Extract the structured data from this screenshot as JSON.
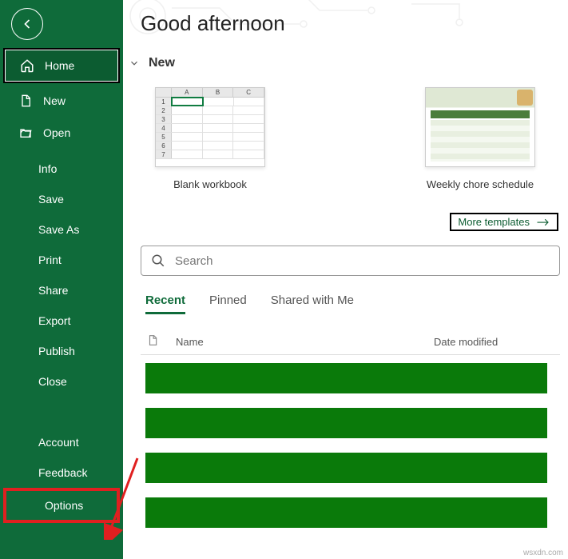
{
  "sidebar": {
    "items": [
      {
        "label": "Home",
        "icon": "home-icon",
        "selected": true
      },
      {
        "label": "New",
        "icon": "document-icon"
      },
      {
        "label": "Open",
        "icon": "folder-icon"
      }
    ],
    "secondary": [
      {
        "label": "Info"
      },
      {
        "label": "Save"
      },
      {
        "label": "Save As"
      },
      {
        "label": "Print"
      },
      {
        "label": "Share"
      },
      {
        "label": "Export"
      },
      {
        "label": "Publish"
      },
      {
        "label": "Close"
      }
    ],
    "bottom": [
      {
        "label": "Account"
      },
      {
        "label": "Feedback"
      },
      {
        "label": "Options"
      }
    ]
  },
  "main": {
    "greeting": "Good afternoon",
    "new_section": "New",
    "templates": [
      {
        "label": "Blank workbook"
      },
      {
        "label": "Weekly chore schedule"
      }
    ],
    "more_templates": "More templates",
    "search": {
      "placeholder": "Search"
    },
    "tabs": [
      {
        "label": "Recent",
        "active": true
      },
      {
        "label": "Pinned"
      },
      {
        "label": "Shared with Me"
      }
    ],
    "columns": {
      "name": "Name",
      "date": "Date modified"
    }
  },
  "watermark": "wsxdn.com"
}
